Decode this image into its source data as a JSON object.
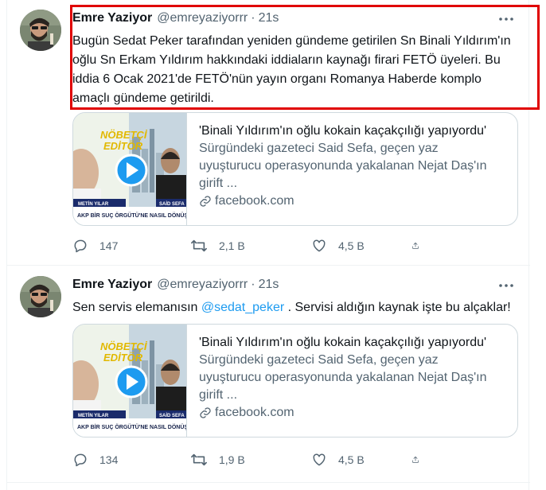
{
  "tweets": [
    {
      "name": "Emre Yaziyor",
      "handle": "@emreyaziyorrr",
      "dot": "·",
      "time": "21s",
      "text": "Bugün Sedat Peker tarafından yeniden gündeme getirilen Sn Binali Yıldırım'ın oğlu Sn Erkam Yıldırım hakkındaki iddiaların kaynağı firari FETÖ üyeleri. Bu iddia 6 Ocak 2021'de FETÖ'nün yayın organı Romanya Haberde komplo amaçlı gündeme getirildi.",
      "card": {
        "title": "'Binali Yıldırım'ın oğlu kokain kaçakçılığı yapıyordu'",
        "description": "Sürgündeki gazeteci Said Sefa, geçen yaz uyuşturucu operasyonunda yakalanan Nejat Daş'ın girift ...",
        "domain": "facebook.com",
        "thumb_brand_1": "NÖBETÇİ",
        "thumb_brand_2": "EDİTÖR",
        "thumb_label_left": "METİN YILAR",
        "thumb_label_right": "SAİD SEFA",
        "thumb_caption": "AKP BİR SUÇ ÖRGÜTÜ'NE NASIL DÖNÜŞTÜ"
      },
      "replies": "147",
      "retweets": "2,1 B",
      "likes": "4,5 B",
      "highlighted": true
    },
    {
      "name": "Emre Yaziyor",
      "handle": "@emreyaziyorrr",
      "dot": "·",
      "time": "21s",
      "text_before": "Sen servis elemanısın ",
      "mention": "@sedat_peker",
      "text_after": " . Servisi aldığın kaynak işte bu alçaklar!",
      "card": {
        "title": "'Binali Yıldırım'ın oğlu kokain kaçakçılığı yapıyordu'",
        "description": "Sürgündeki gazeteci Said Sefa, geçen yaz uyuşturucu operasyonunda yakalanan Nejat Daş'ın girift ...",
        "domain": "facebook.com",
        "thumb_brand_1": "NÖBETÇİ",
        "thumb_brand_2": "EDİTÖR",
        "thumb_label_left": "METİN YILAR",
        "thumb_label_right": "SAİD SEFA",
        "thumb_caption": "AKP BİR SUÇ ÖRGÜTÜ'NE NASIL DÖNÜŞTÜ"
      },
      "replies": "134",
      "retweets": "1,9 B",
      "likes": "4,5 B"
    }
  ],
  "colors": {
    "accent": "#1d9bf0",
    "text_primary": "#0f1419",
    "text_secondary": "#536471",
    "highlight_border": "#e00000",
    "thumb_brand": "#f2c200"
  },
  "icons": [
    "more-icon",
    "reply-icon",
    "retweet-icon",
    "like-icon",
    "share-icon",
    "link-icon",
    "play-icon"
  ]
}
